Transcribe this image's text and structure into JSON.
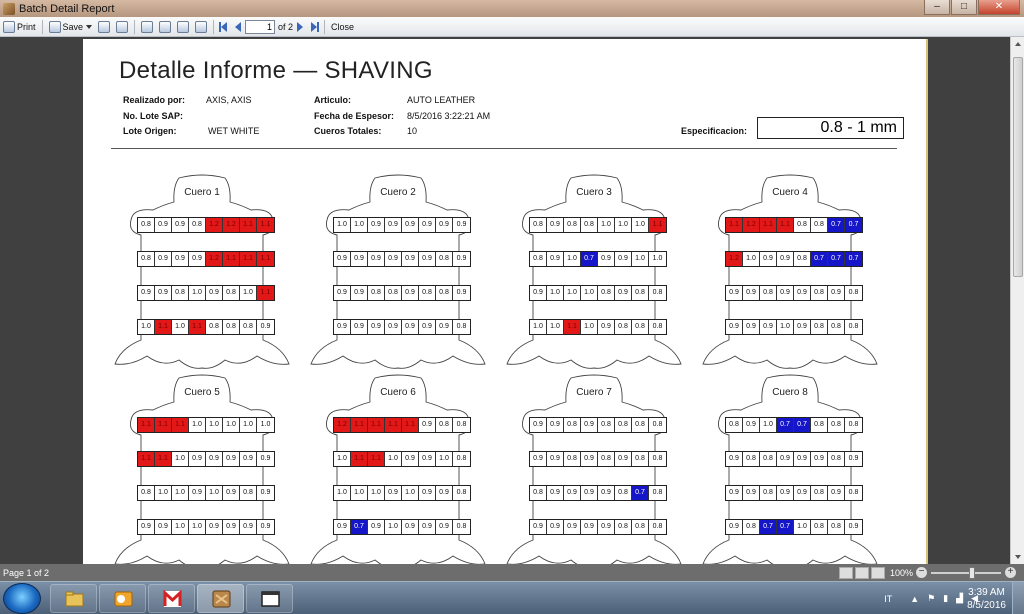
{
  "window": {
    "title": "Batch Detail Report",
    "controls": {
      "minimize": "–",
      "maximize": "□",
      "close": "✕"
    }
  },
  "toolbar": {
    "print_label": "Print",
    "save_label": "Save",
    "page_number": "1",
    "page_of": "of 2",
    "close_label": "Close"
  },
  "report": {
    "title": "Detalle Informe — SHAVING",
    "fields": {
      "realizado_label": "Realizado por:",
      "realizado_value": "AXIS, AXIS",
      "lote_sap_label": "No. Lote SAP:",
      "lote_sap_value": "",
      "lote_origen_label": "Lote Origen:",
      "lote_origen_value": "WET WHITE",
      "articulo_label": "Articulo:",
      "articulo_value": "AUTO LEATHER",
      "fecha_label": "Fecha de Espesor:",
      "fecha_value": "8/5/2016 3:22:21 AM",
      "cueros_label": "Cueros Totales:",
      "cueros_value": "10",
      "especificacion_label": "Especificacion:",
      "especificacion_value": "0.8 - 1 mm"
    },
    "colors": {
      "out_high": "#e21717",
      "out_low": "#1515c9"
    },
    "cueros": [
      {
        "title": "Cuero 1",
        "rows": [
          [
            [
              "0.8",
              ""
            ],
            [
              "0.9",
              ""
            ],
            [
              "0.9",
              ""
            ],
            [
              "0.8",
              ""
            ],
            [
              "1.2",
              "red"
            ],
            [
              "1.2",
              "red"
            ],
            [
              "1.1",
              "red"
            ],
            [
              "1.1",
              "red"
            ]
          ],
          [
            [
              "0.8",
              ""
            ],
            [
              "0.9",
              ""
            ],
            [
              "0.9",
              ""
            ],
            [
              "0.9",
              ""
            ],
            [
              "1.2",
              "red"
            ],
            [
              "1.1",
              "red"
            ],
            [
              "1.1",
              "red"
            ],
            [
              "1.1",
              "red"
            ]
          ],
          [
            [
              "0.9",
              ""
            ],
            [
              "0.9",
              ""
            ],
            [
              "0.8",
              ""
            ],
            [
              "1.0",
              ""
            ],
            [
              "0.9",
              ""
            ],
            [
              "0.8",
              ""
            ],
            [
              "1.0",
              ""
            ],
            [
              "1.1",
              "red"
            ]
          ],
          [
            [
              "1.0",
              ""
            ],
            [
              "1.1",
              "red"
            ],
            [
              "1.0",
              ""
            ],
            [
              "1.1",
              "red"
            ],
            [
              "0.8",
              ""
            ],
            [
              "0.8",
              ""
            ],
            [
              "0.8",
              ""
            ],
            [
              "0.9",
              ""
            ]
          ]
        ]
      },
      {
        "title": "Cuero 2",
        "rows": [
          [
            [
              "1.0",
              ""
            ],
            [
              "1.0",
              ""
            ],
            [
              "0.9",
              ""
            ],
            [
              "0.9",
              ""
            ],
            [
              "0.9",
              ""
            ],
            [
              "0.9",
              ""
            ],
            [
              "0.9",
              ""
            ],
            [
              "0.9",
              ""
            ]
          ],
          [
            [
              "0.9",
              ""
            ],
            [
              "0.9",
              ""
            ],
            [
              "0.9",
              ""
            ],
            [
              "0.9",
              ""
            ],
            [
              "0.9",
              ""
            ],
            [
              "0.9",
              ""
            ],
            [
              "0.8",
              ""
            ],
            [
              "0.9",
              ""
            ]
          ],
          [
            [
              "0.9",
              ""
            ],
            [
              "0.9",
              ""
            ],
            [
              "0.8",
              ""
            ],
            [
              "0.8",
              ""
            ],
            [
              "0.9",
              ""
            ],
            [
              "0.8",
              ""
            ],
            [
              "0.8",
              ""
            ],
            [
              "0.9",
              ""
            ]
          ],
          [
            [
              "0.9",
              ""
            ],
            [
              "0.9",
              ""
            ],
            [
              "0.9",
              ""
            ],
            [
              "0.9",
              ""
            ],
            [
              "0.9",
              ""
            ],
            [
              "0.9",
              ""
            ],
            [
              "0.9",
              ""
            ],
            [
              "0.8",
              ""
            ]
          ]
        ]
      },
      {
        "title": "Cuero 3",
        "rows": [
          [
            [
              "0.8",
              ""
            ],
            [
              "0.9",
              ""
            ],
            [
              "0.8",
              ""
            ],
            [
              "0.8",
              ""
            ],
            [
              "1.0",
              ""
            ],
            [
              "1.0",
              ""
            ],
            [
              "1.0",
              ""
            ],
            [
              "1.1",
              "red"
            ]
          ],
          [
            [
              "0.8",
              ""
            ],
            [
              "0.9",
              ""
            ],
            [
              "1.0",
              ""
            ],
            [
              "0.7",
              "blue"
            ],
            [
              "0.9",
              ""
            ],
            [
              "0.9",
              ""
            ],
            [
              "1.0",
              ""
            ],
            [
              "1.0",
              ""
            ]
          ],
          [
            [
              "0.9",
              ""
            ],
            [
              "1.0",
              ""
            ],
            [
              "1.0",
              ""
            ],
            [
              "1.0",
              ""
            ],
            [
              "0.8",
              ""
            ],
            [
              "0.9",
              ""
            ],
            [
              "0.8",
              ""
            ],
            [
              "0.8",
              ""
            ]
          ],
          [
            [
              "1.0",
              ""
            ],
            [
              "1.0",
              ""
            ],
            [
              "1.1",
              "red"
            ],
            [
              "1.0",
              ""
            ],
            [
              "0.9",
              ""
            ],
            [
              "0.8",
              ""
            ],
            [
              "0.8",
              ""
            ],
            [
              "0.8",
              ""
            ]
          ]
        ]
      },
      {
        "title": "Cuero 4",
        "rows": [
          [
            [
              "1.1",
              "red"
            ],
            [
              "1.2",
              "red"
            ],
            [
              "1.1",
              "red"
            ],
            [
              "1.1",
              "red"
            ],
            [
              "0.8",
              ""
            ],
            [
              "0.8",
              ""
            ],
            [
              "0.7",
              "blue"
            ],
            [
              "0.7",
              "blue"
            ]
          ],
          [
            [
              "1.2",
              "red"
            ],
            [
              "1.0",
              ""
            ],
            [
              "0.9",
              ""
            ],
            [
              "0.9",
              ""
            ],
            [
              "0.8",
              ""
            ],
            [
              "0.7",
              "blue"
            ],
            [
              "0.7",
              "blue"
            ],
            [
              "0.7",
              "blue"
            ]
          ],
          [
            [
              "0.9",
              ""
            ],
            [
              "0.9",
              ""
            ],
            [
              "0.8",
              ""
            ],
            [
              "0.9",
              ""
            ],
            [
              "0.9",
              ""
            ],
            [
              "0.8",
              ""
            ],
            [
              "0.9",
              ""
            ],
            [
              "0.8",
              ""
            ]
          ],
          [
            [
              "0.9",
              ""
            ],
            [
              "0.9",
              ""
            ],
            [
              "0.9",
              ""
            ],
            [
              "1.0",
              ""
            ],
            [
              "0.9",
              ""
            ],
            [
              "0.8",
              ""
            ],
            [
              "0.8",
              ""
            ],
            [
              "0.8",
              ""
            ]
          ]
        ]
      },
      {
        "title": "Cuero 5",
        "rows": [
          [
            [
              "1.1",
              "red"
            ],
            [
              "1.1",
              "red"
            ],
            [
              "1.1",
              "red"
            ],
            [
              "1.0",
              ""
            ],
            [
              "1.0",
              ""
            ],
            [
              "1.0",
              ""
            ],
            [
              "1.0",
              ""
            ],
            [
              "1.0",
              ""
            ]
          ],
          [
            [
              "1.1",
              "red"
            ],
            [
              "1.1",
              "red"
            ],
            [
              "1.0",
              ""
            ],
            [
              "0.9",
              ""
            ],
            [
              "0.9",
              ""
            ],
            [
              "0.9",
              ""
            ],
            [
              "0.9",
              ""
            ],
            [
              "0.9",
              ""
            ]
          ],
          [
            [
              "0.8",
              ""
            ],
            [
              "1.0",
              ""
            ],
            [
              "1.0",
              ""
            ],
            [
              "0.9",
              ""
            ],
            [
              "1.0",
              ""
            ],
            [
              "0.9",
              ""
            ],
            [
              "0.8",
              ""
            ],
            [
              "0.9",
              ""
            ]
          ],
          [
            [
              "0.9",
              ""
            ],
            [
              "0.9",
              ""
            ],
            [
              "1.0",
              ""
            ],
            [
              "1.0",
              ""
            ],
            [
              "0.9",
              ""
            ],
            [
              "0.9",
              ""
            ],
            [
              "0.9",
              ""
            ],
            [
              "0.9",
              ""
            ]
          ]
        ]
      },
      {
        "title": "Cuero 6",
        "rows": [
          [
            [
              "1.2",
              "red"
            ],
            [
              "1.1",
              "red"
            ],
            [
              "1.1",
              "red"
            ],
            [
              "1.1",
              "red"
            ],
            [
              "1.1",
              "red"
            ],
            [
              "0.9",
              ""
            ],
            [
              "0.8",
              ""
            ],
            [
              "0.8",
              ""
            ]
          ],
          [
            [
              "1.0",
              ""
            ],
            [
              "1.1",
              "red"
            ],
            [
              "1.1",
              "red"
            ],
            [
              "1.0",
              ""
            ],
            [
              "0.9",
              ""
            ],
            [
              "0.9",
              ""
            ],
            [
              "1.0",
              ""
            ],
            [
              "0.8",
              ""
            ]
          ],
          [
            [
              "1.0",
              ""
            ],
            [
              "1.0",
              ""
            ],
            [
              "1.0",
              ""
            ],
            [
              "0.9",
              ""
            ],
            [
              "1.0",
              ""
            ],
            [
              "0.9",
              ""
            ],
            [
              "0.9",
              ""
            ],
            [
              "0.8",
              ""
            ]
          ],
          [
            [
              "0.9",
              ""
            ],
            [
              "0.7",
              "blue"
            ],
            [
              "0.9",
              ""
            ],
            [
              "1.0",
              ""
            ],
            [
              "0.9",
              ""
            ],
            [
              "0.9",
              ""
            ],
            [
              "0.9",
              ""
            ],
            [
              "0.8",
              ""
            ]
          ]
        ]
      },
      {
        "title": "Cuero 7",
        "rows": [
          [
            [
              "0.9",
              ""
            ],
            [
              "0.9",
              ""
            ],
            [
              "0.8",
              ""
            ],
            [
              "0.9",
              ""
            ],
            [
              "0.8",
              ""
            ],
            [
              "0.8",
              ""
            ],
            [
              "0.8",
              ""
            ],
            [
              "0.8",
              ""
            ]
          ],
          [
            [
              "0.9",
              ""
            ],
            [
              "0.9",
              ""
            ],
            [
              "0.8",
              ""
            ],
            [
              "0.9",
              ""
            ],
            [
              "0.8",
              ""
            ],
            [
              "0.9",
              ""
            ],
            [
              "0.8",
              ""
            ],
            [
              "0.8",
              ""
            ]
          ],
          [
            [
              "0.8",
              ""
            ],
            [
              "0.9",
              ""
            ],
            [
              "0.9",
              ""
            ],
            [
              "0.9",
              ""
            ],
            [
              "0.9",
              ""
            ],
            [
              "0.8",
              ""
            ],
            [
              "0.7",
              "blue"
            ],
            [
              "0.8",
              ""
            ]
          ],
          [
            [
              "0.9",
              ""
            ],
            [
              "0.9",
              ""
            ],
            [
              "0.9",
              ""
            ],
            [
              "0.9",
              ""
            ],
            [
              "0.9",
              ""
            ],
            [
              "0.8",
              ""
            ],
            [
              "0.8",
              ""
            ],
            [
              "0.8",
              ""
            ]
          ]
        ]
      },
      {
        "title": "Cuero 8",
        "rows": [
          [
            [
              "0.8",
              ""
            ],
            [
              "0.9",
              ""
            ],
            [
              "1.0",
              ""
            ],
            [
              "0.7",
              "blue"
            ],
            [
              "0.7",
              "blue"
            ],
            [
              "0.8",
              ""
            ],
            [
              "0.8",
              ""
            ],
            [
              "0.8",
              ""
            ]
          ],
          [
            [
              "0.9",
              ""
            ],
            [
              "0.8",
              ""
            ],
            [
              "0.8",
              ""
            ],
            [
              "0.9",
              ""
            ],
            [
              "0.9",
              ""
            ],
            [
              "0.9",
              ""
            ],
            [
              "0.8",
              ""
            ],
            [
              "0.9",
              ""
            ]
          ],
          [
            [
              "0.9",
              ""
            ],
            [
              "0.9",
              ""
            ],
            [
              "0.8",
              ""
            ],
            [
              "0.9",
              ""
            ],
            [
              "0.9",
              ""
            ],
            [
              "0.8",
              ""
            ],
            [
              "0.9",
              ""
            ],
            [
              "0.8",
              ""
            ]
          ],
          [
            [
              "0.9",
              ""
            ],
            [
              "0.8",
              ""
            ],
            [
              "0.7",
              "blue"
            ],
            [
              "0.7",
              "blue"
            ],
            [
              "1.0",
              ""
            ],
            [
              "0.8",
              ""
            ],
            [
              "0.8",
              ""
            ],
            [
              "0.9",
              ""
            ]
          ]
        ]
      }
    ]
  },
  "statusbar": {
    "page_status": "Page 1 of 2",
    "zoom": "100%"
  },
  "taskbar": {
    "language": "IT",
    "time": "3:39 AM",
    "date": "8/5/2016"
  }
}
